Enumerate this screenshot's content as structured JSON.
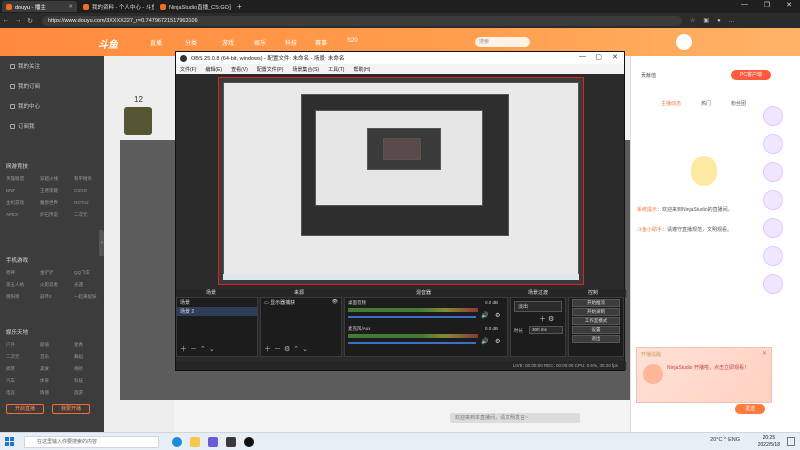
{
  "browser": {
    "tabs": [
      {
        "label": "douyu - 播主",
        "active": true
      },
      {
        "label": "我的资料 - 个人中心 - 斗鱼",
        "active": false
      },
      {
        "label": "NinjaStudio直播_CS:GO直播_",
        "active": false
      }
    ],
    "url": "https://www.douyu.com/3XXXX227_r=0.74796721517963106",
    "window_controls": [
      "—",
      "❐",
      "✕"
    ]
  },
  "site": {
    "logo": "斗鱼",
    "nav": [
      "直播",
      "分类",
      "游戏",
      "娱乐",
      "科技",
      "赛事",
      "S20"
    ],
    "search_placeholder": "搜索",
    "left_nav": {
      "items": [
        "我的关注",
        "我的订阅",
        "我的中心",
        "订阅我"
      ],
      "section1": "网游竞技",
      "section1_cells": [
        "英雄联盟",
        "穿越火线",
        "和平精英",
        "DNF",
        "王者荣耀",
        "CSGO",
        "主机游戏",
        "魔兽世界",
        "DOTA2",
        "APEX",
        "炉石传说",
        "二次元"
      ],
      "section2": "手机游戏",
      "section2_cells": [
        "原神",
        "金铲铲",
        "QQ飞车",
        "第五人格",
        "火影忍者",
        "光遇",
        "阴阳师",
        "崩坏3",
        "一起来捉妖"
      ],
      "section3": "娱乐天地",
      "section3_cells": [
        "户外",
        "颜值",
        "星秀",
        "二次元",
        "音乐",
        "舞蹈",
        "搞笑",
        "美食",
        "视听",
        "汽车",
        "体育",
        "科技",
        "电竞",
        "情感",
        "旅游"
      ],
      "buttons": [
        "开启直播",
        "我要开播"
      ]
    },
    "stream": {
      "level": "12",
      "chat_hint": "欢迎来到本直播间，请文明发言~"
    }
  },
  "right_panel": {
    "top_buttons": [
      "贡献值",
      "PC客户端"
    ],
    "tabs": [
      "主播动态",
      "热门",
      "粉丝团"
    ],
    "messages": [
      {
        "user": "系统提示",
        "text": "欢迎来到NinjaStudio的直播间。"
      },
      {
        "user": "斗鱼小助手",
        "text": "请遵守直播规范，文明观看。"
      }
    ],
    "popup_title": "开播提醒",
    "popup_text": "NinjaStudio 开播啦，点击立即观看！",
    "send_label": "发送"
  },
  "obs": {
    "title": "OBS 25.0.8 (64-bit, windows) - 配置文件: 未命名 - 场景: 未命名",
    "menu": [
      "文件(F)",
      "编辑(E)",
      "查看(V)",
      "配置文件(P)",
      "场景集合(S)",
      "工具(T)",
      "帮助(H)"
    ],
    "docks": [
      "场景",
      "来源",
      "混音器",
      "场景过渡",
      "控制"
    ],
    "scenes": [
      "场景",
      "场景 2"
    ],
    "sources": [
      "显示器捕获"
    ],
    "mixer": [
      {
        "name": "桌面音频",
        "db": "0.0 dB"
      },
      {
        "name": "麦克风/Aux",
        "db": "0.0 dB"
      }
    ],
    "transition": {
      "type": "淡出",
      "duration_label": "时长",
      "duration": "300 ms"
    },
    "controls": [
      "开始推流",
      "开始录制",
      "工作室模式",
      "设置",
      "退出"
    ],
    "status": "LIVE: 00:00:00   REC: 00:00:00   CPU: 0.6%, 30.00 fps"
  },
  "taskbar": {
    "search_placeholder": "在这里输入你要搜索的内容",
    "tray": "20°C  ^  ENG",
    "time": "20:25",
    "date": "2022/5/18"
  },
  "colors": {
    "accent": "#ff8a3d",
    "obs_bg": "#2a2a2a",
    "preview_border": "#dd2222"
  }
}
